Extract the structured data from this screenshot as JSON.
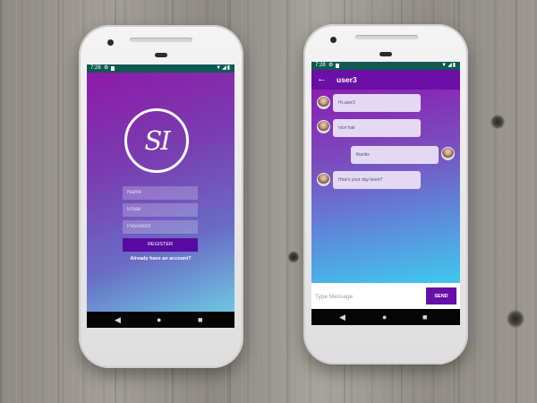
{
  "login_screen": {
    "status_time": "7:26",
    "logo_text": "SI",
    "name_placeholder": "Name",
    "email_placeholder": "Email",
    "password_placeholder": "Password",
    "register_label": "REGISTER",
    "login_link": "Already have an account?"
  },
  "chat_screen": {
    "status_time": "7:28",
    "back_icon": "arrow-left-icon",
    "title": "user3",
    "messages": [
      {
        "text": "Hi user3",
        "sender": "other"
      },
      {
        "text": "nice hair",
        "sender": "other"
      },
      {
        "text": "thanks",
        "sender": "me"
      },
      {
        "text": "How's your day been?",
        "sender": "other"
      }
    ],
    "input_placeholder": "Type Message",
    "send_label": "SEND"
  },
  "nav_icons": [
    "back-triangle-icon",
    "home-circle-icon",
    "recents-square-icon"
  ],
  "colors": {
    "accent_purple": "#6b0fa6",
    "button_purple": "#5a0aa0",
    "status_bar": "#0f5a52",
    "bubble": "#e3d9f5"
  }
}
